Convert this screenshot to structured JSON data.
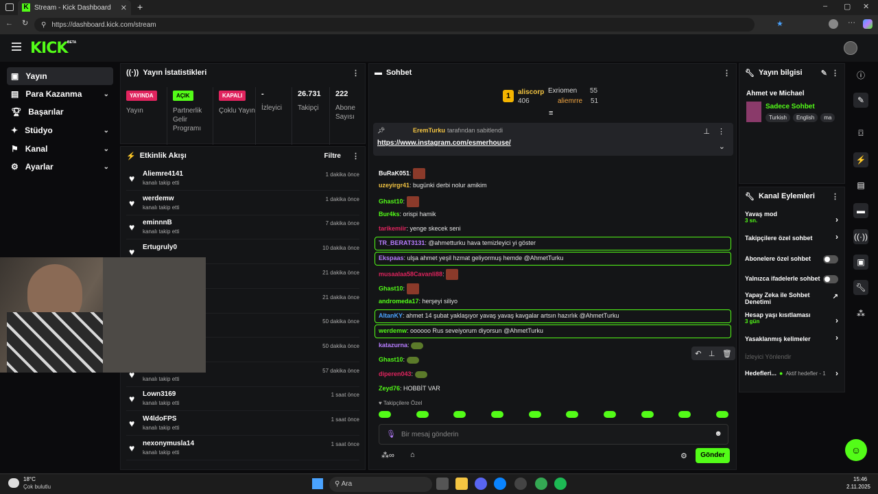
{
  "browser": {
    "tab_title": "Stream - Kick Dashboard",
    "url": "https://dashboard.kick.com/stream"
  },
  "brand": {
    "logo": "KICK",
    "beta": "BETA",
    "accent": "#53fc18"
  },
  "sidebar": {
    "items": [
      {
        "label": "Yayın",
        "icon": "broadcast-icon"
      },
      {
        "label": "Para Kazanma",
        "icon": "money-icon"
      },
      {
        "label": "Başarılar",
        "icon": "trophy-icon"
      },
      {
        "label": "Stüdyo",
        "icon": "studio-icon"
      },
      {
        "label": "Kanal",
        "icon": "channel-icon"
      },
      {
        "label": "Ayarlar",
        "icon": "gear-icon"
      }
    ]
  },
  "stats": {
    "title": "Yayın İstatistikleri",
    "cells": [
      {
        "badge": "YAYINDA",
        "label": "Yayın"
      },
      {
        "badge": "AÇIK",
        "label": "Partnerlik Gelir Programı"
      },
      {
        "badge": "KAPALI",
        "label": "Çoklu Yayın"
      },
      {
        "value": "-",
        "label": "İzleyici"
      },
      {
        "value": "26.731",
        "label": "Takipçi"
      },
      {
        "value": "222",
        "label": "Abone Sayısı"
      }
    ]
  },
  "activity": {
    "title": "Etkinlik Akışı",
    "filter": "Filtre",
    "items": [
      {
        "name": "Aliemre4141",
        "sub": "kanalı takip etti",
        "time": "1 dakika önce"
      },
      {
        "name": "werdemw",
        "sub": "kanalı takip etti",
        "time": "1 dakika önce"
      },
      {
        "name": "eminnnB",
        "sub": "kanalı takip etti",
        "time": "7 dakika önce"
      },
      {
        "name": "Ertugruly0",
        "sub": "",
        "time": "10 dakika önce"
      },
      {
        "name": "",
        "sub": "",
        "time": "21 dakika önce"
      },
      {
        "name": "",
        "sub": "",
        "time": "21 dakika önce"
      },
      {
        "name": "",
        "sub": "",
        "time": "50 dakika önce"
      },
      {
        "name": "",
        "sub": "",
        "time": "50 dakika önce"
      },
      {
        "name": "",
        "sub": "kanalı takip etti",
        "time": "57 dakika önce"
      },
      {
        "name": "Lown3169",
        "sub": "kanalı takip etti",
        "time": "1 saat önce"
      },
      {
        "name": "W4ldoFPS",
        "sub": "kanalı takip etti",
        "time": "1 saat önce"
      },
      {
        "name": "nexonymusla14",
        "sub": "kanalı takip etti",
        "time": "1 saat önce"
      }
    ]
  },
  "chat": {
    "title": "Sohbet",
    "leaders": [
      {
        "rank": "1",
        "name": "aliscorp",
        "count": "406"
      },
      {
        "name": "Exriomen",
        "count": "55"
      },
      {
        "name": "aliemrre",
        "count": "51"
      }
    ],
    "pinned": {
      "by": "EremTurku",
      "text": "tarafından sabitlendi",
      "link": "https://www.instagram.com/esmerhouse/"
    },
    "messages": [
      {
        "user": "BuRaK051",
        "color": "#ffffff",
        "text": ":"
      },
      {
        "user": "uzeyirgr41",
        "color": "#f4c542",
        "text": ": bugünki derbi nolur amikim"
      },
      {
        "user": "Ghast10",
        "color": "#53fc18",
        "text": ":"
      },
      {
        "user": "Bur4ks",
        "color": "#53fc18",
        "text": ": orispi hamik"
      },
      {
        "user": "tarikemiir",
        "color": "#e0245e",
        "text": ": yenge skecek seni"
      },
      {
        "user": "TR_BERAT3131",
        "color": "#b77dff",
        "text": ": @ahmetturku hava temizleyici yi göster"
      },
      {
        "user": "Ekspaas",
        "color": "#b77dff",
        "text": ": ulşa ahmet yeşil hzmat geliyormuş hemde @AhmetTurku"
      },
      {
        "user": "musaalaa58Cavanli88",
        "color": "#e0245e",
        "text": ":"
      },
      {
        "user": "Ghast10",
        "color": "#53fc18",
        "text": ":"
      },
      {
        "user": "andromeda17",
        "color": "#53fc18",
        "text": ": herşeyi siliyo"
      },
      {
        "user": "AltanKY",
        "color": "#4aa3ff",
        "text": ": ahmet 14 şubat yaklaşıyor yavaş yavaş kavgalar artsın hazırlık @AhmetTurku"
      },
      {
        "user": "werdemw",
        "color": "#53fc18",
        "text": ": oooooo Rus seveiyorum diyorsun @AhmetTurku"
      },
      {
        "user": "katazurna",
        "color": "#b77dff",
        "text": ":"
      },
      {
        "user": "Ghast10",
        "color": "#53fc18",
        "text": ":"
      },
      {
        "user": "diperen043",
        "color": "#e0245e",
        "text": ":"
      },
      {
        "user": "Zeyd76",
        "color": "#53fc18",
        "text": ": HOBBİT VAR"
      }
    ],
    "followers_only": "Takipçilere Özel",
    "input_placeholder": "Bir mesaj gönderin",
    "send_label": "Gönder"
  },
  "stream_info": {
    "title": "Yayın bilgisi",
    "stream_title": "Ahmet ve Michael",
    "category": "Sadece Sohbet",
    "tags": [
      "Turkish",
      "English",
      "ma"
    ]
  },
  "channel_actions": {
    "title": "Kanal Eylemleri",
    "items": [
      {
        "label": "Yavaş mod",
        "sub": "3 sn."
      },
      {
        "label": "Takipçilere özel sohbet",
        "sub": ""
      },
      {
        "label": "Abonelere özel sohbet",
        "sub": ""
      },
      {
        "label": "Yalnızca ifadelerle sohbet",
        "sub": ""
      },
      {
        "label": "Yapay Zeka ile Sohbet Denetimi",
        "sub": ""
      },
      {
        "label": "Hesap yaşı kısıtlaması",
        "sub": "3 gün"
      },
      {
        "label": "Yasaklanmış kelimeler",
        "sub": ""
      },
      {
        "label": "İzleyici Yönlendir",
        "sub": ""
      },
      {
        "label": "Hedefleri...",
        "sub": "Aktif hedefler - 1"
      }
    ]
  },
  "taskbar": {
    "temp": "18°C",
    "weather": "Çok bulutlu",
    "search": "Ara",
    "time": "15:46",
    "date": "2.11.2025"
  }
}
